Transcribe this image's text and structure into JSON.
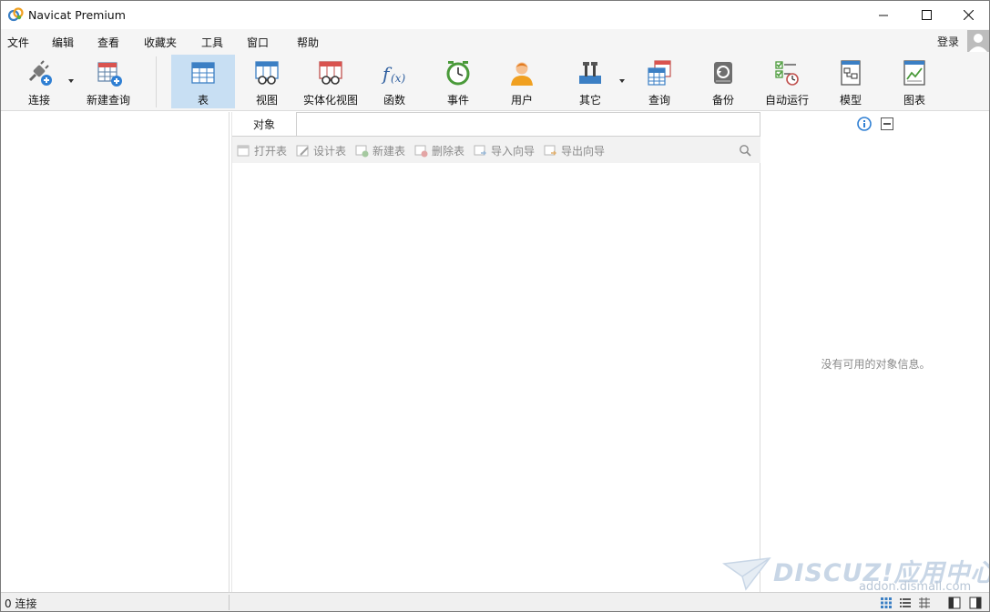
{
  "window": {
    "title": "Navicat Premium"
  },
  "menu": {
    "items": [
      "文件",
      "编辑",
      "查看",
      "收藏夹",
      "工具",
      "窗口",
      "帮助"
    ],
    "login": "登录"
  },
  "toolbar": {
    "items": [
      {
        "label": "连接",
        "icon": "connection-plug-icon"
      },
      {
        "label": "新建查询",
        "icon": "new-query-icon"
      },
      {
        "label": "表",
        "icon": "table-icon",
        "active": true
      },
      {
        "label": "视图",
        "icon": "view-icon"
      },
      {
        "label": "实体化视图",
        "icon": "materialized-view-icon"
      },
      {
        "label": "函数",
        "icon": "function-icon"
      },
      {
        "label": "事件",
        "icon": "event-clock-icon"
      },
      {
        "label": "用户",
        "icon": "user-icon"
      },
      {
        "label": "其它",
        "icon": "tools-icon"
      },
      {
        "label": "查询",
        "icon": "query-icon"
      },
      {
        "label": "备份",
        "icon": "backup-icon"
      },
      {
        "label": "自动运行",
        "icon": "automation-icon"
      },
      {
        "label": "模型",
        "icon": "model-icon"
      },
      {
        "label": "图表",
        "icon": "chart-icon"
      }
    ]
  },
  "object_panel": {
    "tab": "对象",
    "actions": [
      "打开表",
      "设计表",
      "新建表",
      "删除表",
      "导入向导",
      "导出向导"
    ]
  },
  "info_panel": {
    "empty_message": "没有可用的对象信息。"
  },
  "status": {
    "connections": "0 连接"
  },
  "watermark": {
    "brand": "DISCUZ!应用中心",
    "url": "addon.dismall.com"
  },
  "colors": {
    "active_tab": "#c8dff3",
    "accent_blue": "#3b7fc4",
    "toolbar_bg": "#f5f5f5"
  }
}
